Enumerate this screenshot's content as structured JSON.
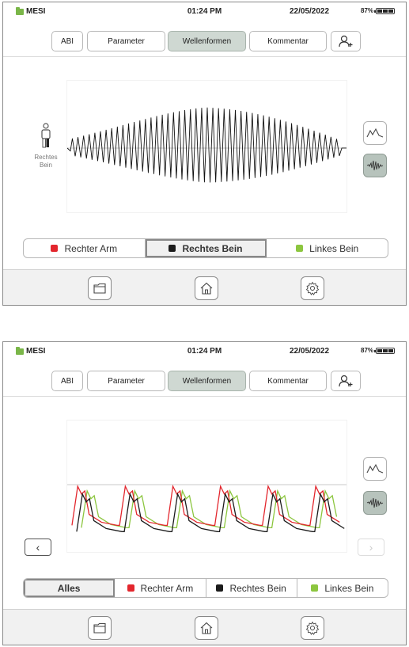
{
  "status": {
    "brand": "MESI",
    "time": "01:24 PM",
    "date": "22/05/2022",
    "battery": "87%"
  },
  "tabs": {
    "abi": "ABI",
    "parameter": "Parameter",
    "wellenformen": "Wellenformen",
    "kommentar": "Kommentar",
    "active": "Wellenformen"
  },
  "colors": {
    "accent_green": "#7ab648",
    "right_arm": "#e3262d",
    "right_leg": "#1b1b1b",
    "left_leg": "#8cc63f",
    "tab_active": "#cfd8d2"
  },
  "icons": [
    "add-patient-icon",
    "folder-icon",
    "home-icon",
    "settings-gear-icon",
    "pulse-waveform-icon",
    "oscillation-waveform-icon",
    "person-icon",
    "chevron-left-icon",
    "chevron-right-icon"
  ],
  "screen1": {
    "person_label": "Rechtes\nBein",
    "legend": [
      {
        "label": "Rechter Arm",
        "color": "#e3262d",
        "active": false
      },
      {
        "label": "Rechtes Bein",
        "color": "#1b1b1b",
        "active": true
      },
      {
        "label": "Linkes Bein",
        "color": "#8cc63f",
        "active": false
      }
    ],
    "view": "oscillation"
  },
  "screen2": {
    "legend": [
      {
        "label": "Alles",
        "active": true
      },
      {
        "label": "Rechter Arm",
        "color": "#e3262d",
        "active": false
      },
      {
        "label": "Rechtes Bein",
        "color": "#1b1b1b",
        "active": false
      },
      {
        "label": "Linkes Bein",
        "color": "#8cc63f",
        "active": false
      }
    ],
    "view": "oscillation",
    "pulse_count": 6
  }
}
